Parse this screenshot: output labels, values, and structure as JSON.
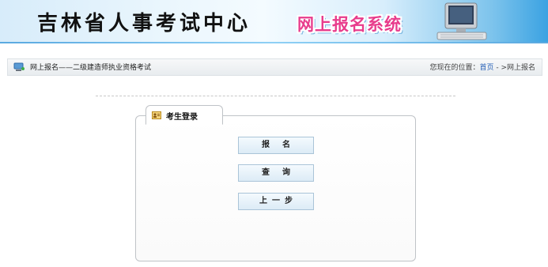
{
  "header": {
    "center_name": "吉林省人事考试中心",
    "system_name": "网上报名系统"
  },
  "location_bar": {
    "section_title": "网上报名——二级建造师执业资格考试",
    "you_are_here": "您现在的位置：",
    "home_link": "首页",
    "separator": " - >",
    "current_page": "网上报名"
  },
  "login_panel": {
    "tab_title": "考生登录",
    "buttons": {
      "register": "报名",
      "query": "查询",
      "back": "上一步"
    }
  },
  "colors": {
    "system_title": "#e83c8c",
    "link": "#2a63b8",
    "button_border": "#aac4d8"
  }
}
